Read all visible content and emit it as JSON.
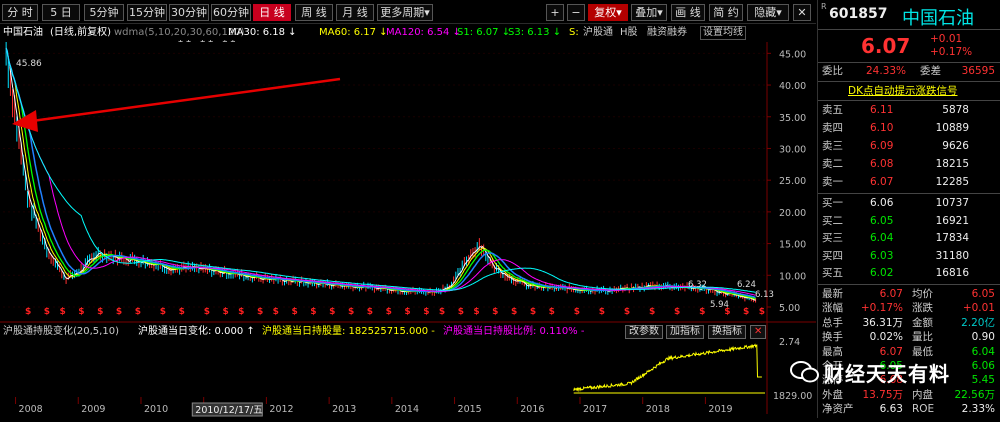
{
  "toolbar": {
    "periods": [
      "分 时",
      "5 日",
      "5分钟",
      "15分钟",
      "30分钟",
      "60分钟",
      "日 线",
      "周 线",
      "月 线",
      "更多周期"
    ],
    "active_period": "日 线",
    "right_buttons": [
      "+",
      "−",
      "复权",
      "叠加",
      "画 线",
      "简 约",
      "隐藏"
    ],
    "dropdown_glyph": "▾"
  },
  "chart_info": {
    "stock": "中国石油",
    "mode": "(日线,前复权)",
    "wdma": "wdma(5,10,20,30,60,120)",
    "ma30": "MA30: 6.18 ↓",
    "ma60": "MA60: 6.17 ↓",
    "ma120": "MA120: 6.54 ↓",
    "s1": "S1: 6.07 ↓",
    "s3": "S3: 6.13 ↓",
    "s": "S:",
    "hugu": "沪股通",
    "hgu": "H股",
    "rzrq": "融资融券",
    "settings": "设置均线",
    "stars": "** ** **",
    "high_label": "45.86",
    "mark_labels": [
      "6.32",
      "6.24",
      "5.94",
      "6.13"
    ]
  },
  "chart_data": {
    "type": "line",
    "title": "中国石油 (日线,前复权)",
    "x": [
      2007.85,
      2008.0,
      2008.2,
      2008.5,
      2008.8,
      2009.0,
      2009.3,
      2009.6,
      2009.9,
      2010.2,
      2010.5,
      2010.8,
      2011.1,
      2011.5,
      2011.9,
      2012.3,
      2012.7,
      2013.1,
      2013.5,
      2013.9,
      2014.3,
      2014.7,
      2014.95,
      2015.2,
      2015.4,
      2015.6,
      2015.9,
      2016.2,
      2016.6,
      2017.0,
      2017.4,
      2017.8,
      2018.2,
      2018.6,
      2019.0,
      2019.4,
      2019.8
    ],
    "y": [
      45.86,
      35.0,
      22.0,
      14.0,
      9.5,
      10.5,
      13.5,
      12.8,
      12.5,
      11.8,
      11.0,
      11.2,
      10.8,
      10.2,
      9.6,
      9.2,
      8.8,
      8.5,
      8.2,
      7.9,
      7.5,
      7.4,
      8.5,
      12.5,
      15.0,
      11.5,
      9.5,
      8.3,
      8.0,
      7.8,
      7.6,
      7.9,
      8.4,
      8.2,
      7.8,
      7.0,
      6.07
    ],
    "ylim": [
      5,
      46
    ],
    "yticks": [
      "45.00",
      "40.00",
      "35.00",
      "30.00",
      "25.00",
      "20.00",
      "15.00",
      "10.00",
      "5.00"
    ],
    "xticks": [
      "2008",
      "2009",
      "2010",
      "2011",
      "2012",
      "2013",
      "2014",
      "2015",
      "2016",
      "2017",
      "2018",
      "2019"
    ],
    "date_cursor": "2010/12/17/五",
    "indicator_ticks": [
      "2.74",
      "1829.00"
    ]
  },
  "indicator": {
    "name": "沪股通持股变化(20,5,10)",
    "daily_change": "沪股通当日变化: 0.000 ↑",
    "holdings": "沪股通当日持股量: 182525715.000 -",
    "ratio": "沪股通当日持股比例: 0.110% -",
    "buttons": [
      "改参数",
      "加指标",
      "换指标"
    ],
    "close": "✕"
  },
  "quote": {
    "code": "601857",
    "name": "中国石油",
    "price": "6.07",
    "change": "+0.01",
    "change_pct": "+0.17%",
    "webi_label": "委比",
    "webi": "24.33%",
    "weicha_label": "委差",
    "weicha": "36595",
    "signal": "DK点自动提示涨跌信号",
    "asks": [
      {
        "label": "卖五",
        "price": "6.11",
        "vol": "5878"
      },
      {
        "label": "卖四",
        "price": "6.10",
        "vol": "10889"
      },
      {
        "label": "卖三",
        "price": "6.09",
        "vol": "9626"
      },
      {
        "label": "卖二",
        "price": "6.08",
        "vol": "18215"
      },
      {
        "label": "卖一",
        "price": "6.07",
        "vol": "12285"
      }
    ],
    "bids": [
      {
        "label": "买一",
        "price": "6.06",
        "vol": "10737"
      },
      {
        "label": "买二",
        "price": "6.05",
        "vol": "16921"
      },
      {
        "label": "买三",
        "price": "6.04",
        "vol": "17834"
      },
      {
        "label": "买四",
        "price": "6.03",
        "vol": "31180"
      },
      {
        "label": "买五",
        "price": "6.02",
        "vol": "16816"
      }
    ],
    "stats": [
      {
        "l1": "最新",
        "v1": "6.07",
        "l2": "均价",
        "v2": "6.05"
      },
      {
        "l1": "涨幅",
        "v1": "+0.17%",
        "l2": "涨跌",
        "v2": "+0.01"
      },
      {
        "l1": "总手",
        "v1": "36.31万",
        "l2": "金额",
        "v2": "2.20亿"
      },
      {
        "l1": "换手",
        "v1": "0.02%",
        "l2": "量比",
        "v2": "0.90"
      },
      {
        "l1": "最高",
        "v1": "6.07",
        "l2": "最低",
        "v2": "6.04"
      },
      {
        "l1": "今开",
        "v1": "6.05",
        "l2": "",
        "v2": "6.06"
      },
      {
        "l1": "涨停",
        "v1": "6.68",
        "l2": "",
        "v2": "5.45"
      },
      {
        "l1": "外盘",
        "v1": "13.75万",
        "l2": "内盘",
        "v2": "22.56万"
      },
      {
        "l1": "净资产",
        "v1": "6.63",
        "l2": "ROE",
        "v2": "2.33%"
      }
    ]
  },
  "watermark": {
    "text": "财经天天有料"
  }
}
